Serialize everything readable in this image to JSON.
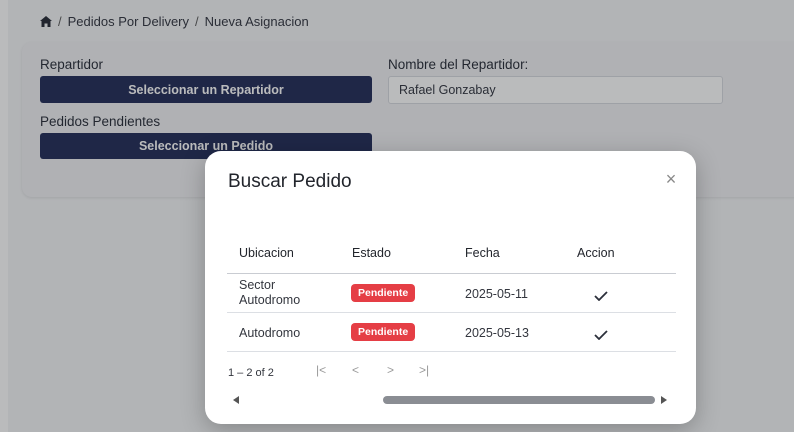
{
  "breadcrumb": {
    "sep": "/",
    "items": [
      "Pedidos Por Delivery",
      "Nueva Asignacion"
    ]
  },
  "form": {
    "repartidor_label": "Repartidor",
    "select_repartidor_button": "Seleccionar un Repartidor",
    "nombre_label": "Nombre del Repartidor:",
    "nombre_value": "Rafael Gonzabay",
    "pedidos_label": "Pedidos Pendientes",
    "select_pedido_button": "Seleccionar un Pedido"
  },
  "modal": {
    "title": "Buscar Pedido",
    "close": "×",
    "columns": [
      "Ubicacion",
      "Estado",
      "Fecha",
      "Accion"
    ],
    "rows": [
      {
        "ubicacion_1": "Sector",
        "ubicacion_2": "Autodromo",
        "estado": "Pendiente",
        "fecha": "2025-05-11"
      },
      {
        "ubicacion_1": "Autodromo",
        "ubicacion_2": "",
        "estado": "Pendiente",
        "fecha": "2025-05-13"
      }
    ],
    "pagination": {
      "range": "1 – 2 of 2",
      "first": "|<",
      "prev": "<",
      "next": ">",
      "last": ">|"
    }
  },
  "colors": {
    "primary": "#1b2553",
    "badge": "#e53e45",
    "overlay": "rgba(40,42,48,0.32)"
  }
}
